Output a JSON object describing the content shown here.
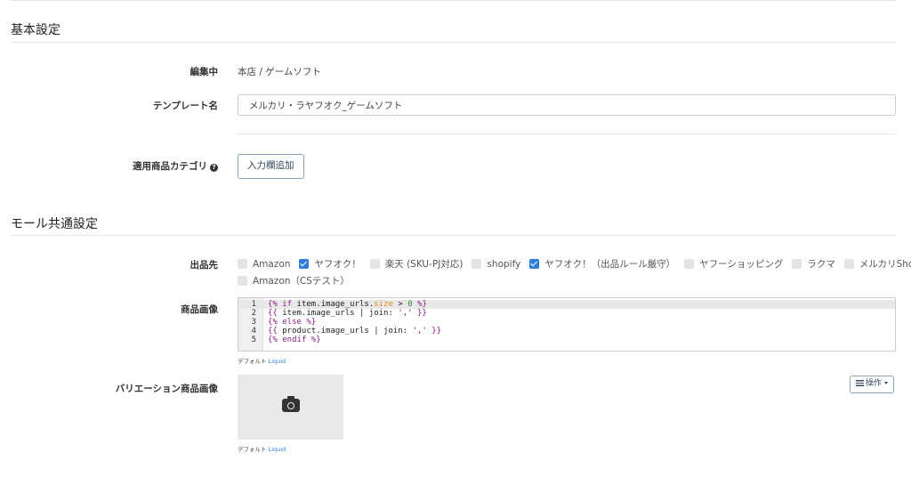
{
  "sections": {
    "basic_title": "基本設定",
    "mall_common_title": "モール共通設定"
  },
  "editing": {
    "label": "編集中",
    "value": "本店 / ゲームソフト"
  },
  "template_name": {
    "label": "テンプレート名",
    "value": "メルカリ・ラヤフオク_ゲームソフト"
  },
  "category": {
    "label": "適用商品カテゴリ",
    "help_icon": "question-circle-icon",
    "add_button": "入力欄追加"
  },
  "destinations": {
    "label": "出品先",
    "options": [
      {
        "label": "Amazon",
        "checked": false
      },
      {
        "label": "ヤフオク！",
        "checked": true
      },
      {
        "label": "楽天 (SKU-PJ対応)",
        "checked": false
      },
      {
        "label": "shopify",
        "checked": false
      },
      {
        "label": "ヤフオク！（出品ルール厳守）",
        "checked": true
      },
      {
        "label": "ヤフーショッピング",
        "checked": false
      },
      {
        "label": "ラクマ",
        "checked": false
      },
      {
        "label": "メルカリShops",
        "checked": false
      },
      {
        "label": "Amazon（CSテスト）",
        "checked": false
      }
    ]
  },
  "product_image": {
    "label": "商品画像",
    "code_lines": [
      {
        "num": "1",
        "text": "{% if item.image_urls.size > 0 %}"
      },
      {
        "num": "2",
        "text": "{{ item.image_urls | join: ',' }}"
      },
      {
        "num": "3",
        "text": "{% else %}"
      },
      {
        "num": "4",
        "text": "{{ product.image_urls | join: ',' }}"
      },
      {
        "num": "5",
        "text": "{% endif %}"
      }
    ],
    "note_default": "デフォルト",
    "note_link": "Liquid"
  },
  "variation_image": {
    "label": "バリエーション商品画像",
    "placeholder_icon": "camera-icon",
    "ops_button": "操作",
    "ops_icon": "list-icon",
    "note_default": "デフォルト",
    "note_link": "Liquid"
  },
  "colors": {
    "accent": "#2f7fd6",
    "button_border": "#8aa4bf"
  }
}
